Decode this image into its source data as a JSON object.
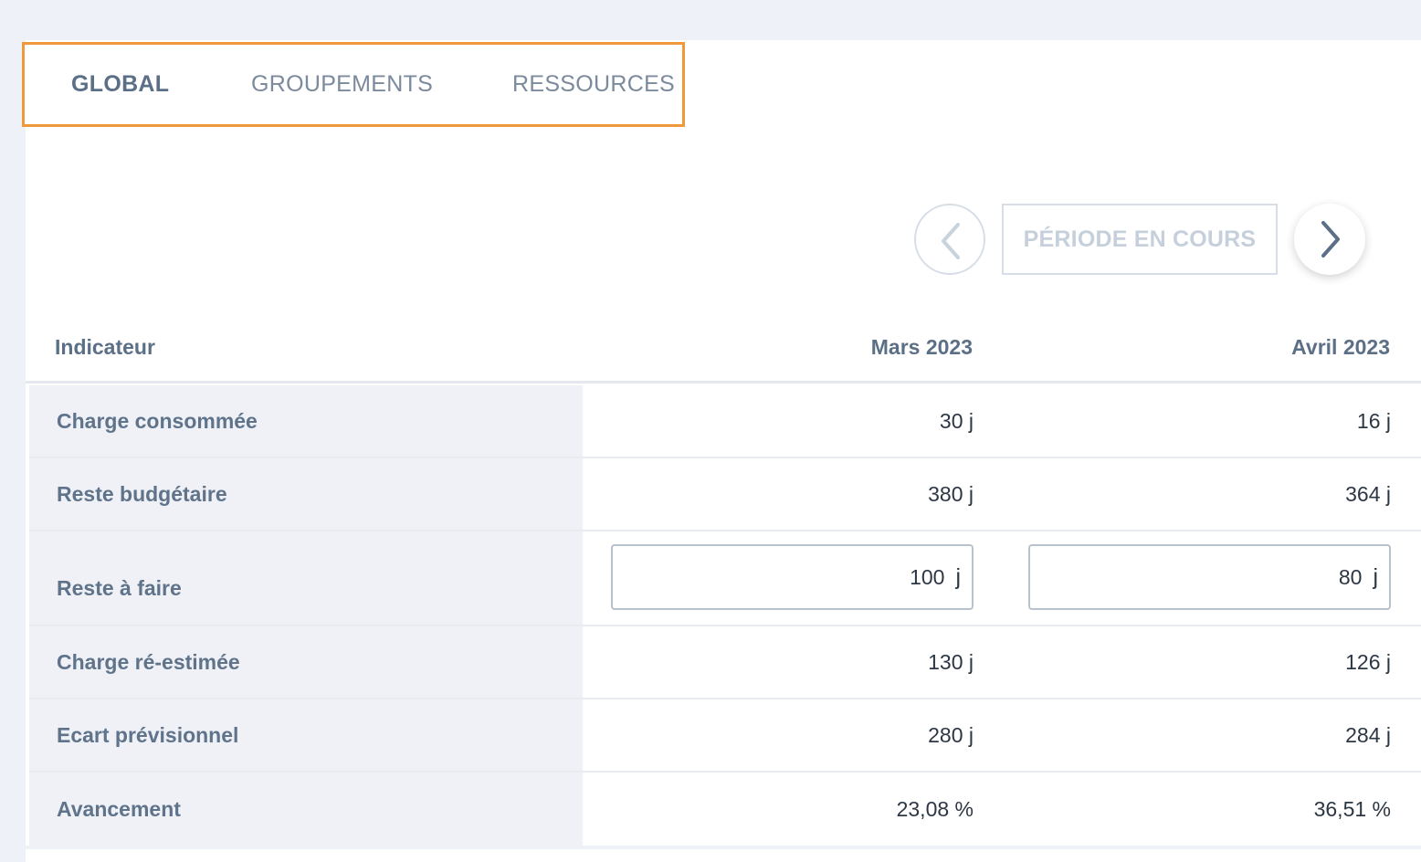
{
  "tabs": [
    {
      "label": "GLOBAL",
      "active": true
    },
    {
      "label": "GROUPEMENTS",
      "active": false
    },
    {
      "label": "RESSOURCES",
      "active": false
    }
  ],
  "period_nav": {
    "prev_icon": "chevron-left-icon",
    "current_label": "PÉRIODE EN COURS",
    "next_icon": "chevron-right-icon"
  },
  "table": {
    "headers": {
      "indicator": "Indicateur",
      "col1": "Mars 2023",
      "col2": "Avril 2023"
    },
    "rows": [
      {
        "label": "Charge consommée",
        "v1": "30 j",
        "v2": "16 j"
      },
      {
        "label": "Reste budgétaire",
        "v1": "380 j",
        "v2": "364 j"
      },
      {
        "label": "Reste à faire",
        "v1": "100",
        "v2": "80",
        "unit": "j"
      },
      {
        "label": "Charge ré-estimée",
        "v1": "130 j",
        "v2": "126 j"
      },
      {
        "label": "Ecart prévisionnel",
        "v1": "280 j",
        "v2": "284 j"
      },
      {
        "label": "Avancement",
        "v1": "23,08 %",
        "v2": "36,51 %"
      }
    ]
  },
  "colors": {
    "tab_highlight": "#f0993a",
    "label_bg": "#eff1f6",
    "text": "#5b6f87"
  }
}
